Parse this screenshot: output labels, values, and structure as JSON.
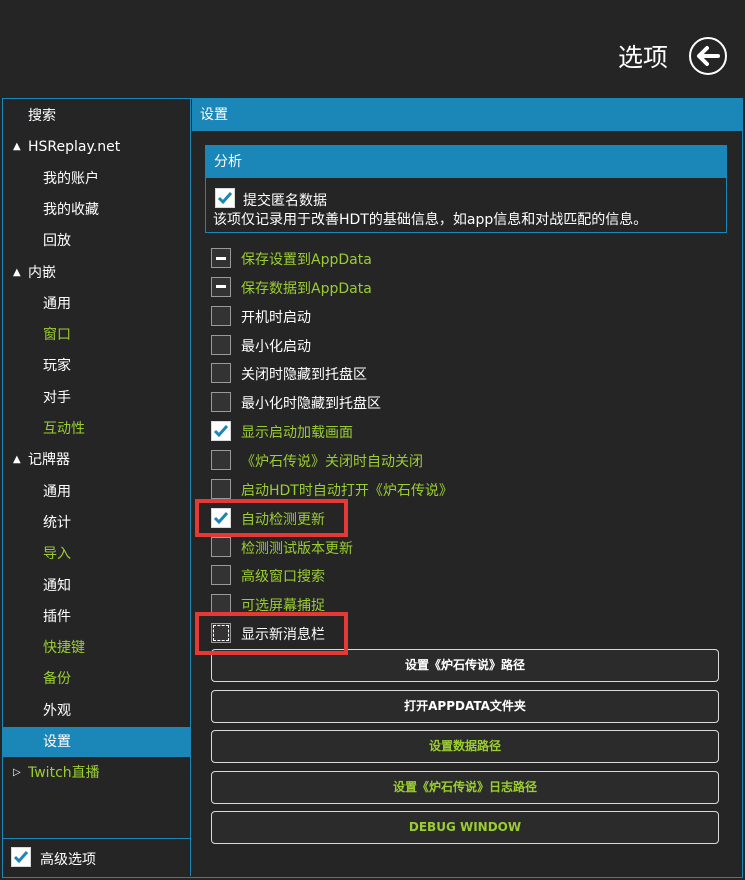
{
  "header": {
    "title": "选项"
  },
  "sidebar": {
    "items": [
      {
        "label": "搜索",
        "level": 0,
        "green": false
      },
      {
        "label": "HSReplay.net",
        "level": 0,
        "green": false,
        "arrow": "▲"
      },
      {
        "label": "我的账户",
        "level": 1,
        "green": false
      },
      {
        "label": "我的收藏",
        "level": 1,
        "green": false
      },
      {
        "label": "回放",
        "level": 1,
        "green": false
      },
      {
        "label": "内嵌",
        "level": 0,
        "green": false,
        "arrow": "▲"
      },
      {
        "label": "通用",
        "level": 1,
        "green": false
      },
      {
        "label": "窗口",
        "level": 1,
        "green": true
      },
      {
        "label": "玩家",
        "level": 1,
        "green": false
      },
      {
        "label": "对手",
        "level": 1,
        "green": false
      },
      {
        "label": "互动性",
        "level": 1,
        "green": true
      },
      {
        "label": "记牌器",
        "level": 0,
        "green": false,
        "arrow": "▲"
      },
      {
        "label": "通用",
        "level": 1,
        "green": false
      },
      {
        "label": "统计",
        "level": 1,
        "green": false
      },
      {
        "label": "导入",
        "level": 1,
        "green": true
      },
      {
        "label": "通知",
        "level": 1,
        "green": false
      },
      {
        "label": "插件",
        "level": 1,
        "green": false
      },
      {
        "label": "快捷键",
        "level": 1,
        "green": true
      },
      {
        "label": "备份",
        "level": 1,
        "green": true
      },
      {
        "label": "外观",
        "level": 1,
        "green": false
      },
      {
        "label": "设置",
        "level": 1,
        "green": false,
        "selected": true
      },
      {
        "label": "Twitch直播",
        "level": 0,
        "green": true,
        "arrow": "▷"
      }
    ],
    "advanced_label": "高级选项"
  },
  "content": {
    "header": "设置",
    "analysis": {
      "header": "分析",
      "checkbox_label": "提交匿名数据",
      "description": "该项仅记录用于改善HDT的基础信息，如app信息和对战匹配的信息。"
    },
    "options": [
      {
        "label": "保存设置到AppData",
        "state": "indeterminate",
        "green": true
      },
      {
        "label": "保存数据到AppData",
        "state": "indeterminate",
        "green": true
      },
      {
        "label": "开机时启动",
        "state": "unchecked",
        "green": false
      },
      {
        "label": "最小化启动",
        "state": "unchecked",
        "green": false
      },
      {
        "label": "关闭时隐藏到托盘区",
        "state": "unchecked",
        "green": false
      },
      {
        "label": "最小化时隐藏到托盘区",
        "state": "unchecked",
        "green": false
      },
      {
        "label": "显示启动加载画面",
        "state": "checked",
        "green": true
      },
      {
        "label": "《炉石传说》关闭时自动关闭",
        "state": "unchecked",
        "green": true
      },
      {
        "label": "启动HDT时自动打开《炉石传说》",
        "state": "unchecked",
        "green": true
      },
      {
        "label": "自动检测更新",
        "state": "checked",
        "green": true
      },
      {
        "label": "检测测试版本更新",
        "state": "unchecked",
        "green": true
      },
      {
        "label": "高级窗口搜索",
        "state": "unchecked",
        "green": true
      },
      {
        "label": "可选屏幕捕捉",
        "state": "unchecked",
        "green": true
      },
      {
        "label": "显示新消息栏",
        "state": "focused",
        "green": false
      }
    ],
    "buttons": [
      {
        "label": "设置《炉石传说》路径",
        "green": false
      },
      {
        "label": "打开APPDATA文件夹",
        "green": false
      },
      {
        "label": "设置数据路径",
        "green": true
      },
      {
        "label": "设置《炉石传说》日志路径",
        "green": true
      },
      {
        "label": "DEBUG WINDOW",
        "green": true
      }
    ]
  },
  "colors": {
    "accent": "#1b86b8",
    "green": "#9acd32",
    "highlight": "#e53935",
    "background": "#252526"
  }
}
